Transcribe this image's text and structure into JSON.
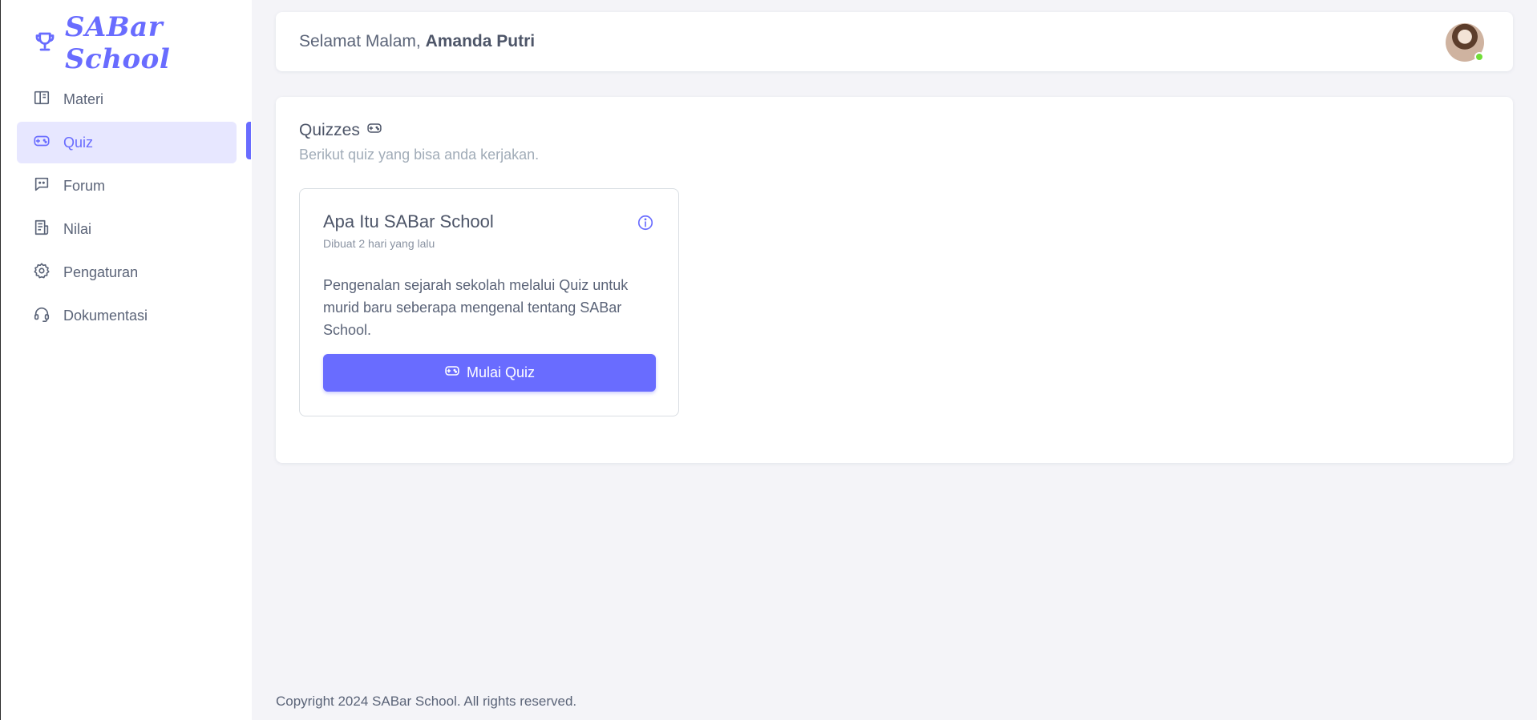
{
  "brand": {
    "name": "SABar School",
    "icon": "trophy-icon",
    "color": "#696cff"
  },
  "sidebar": {
    "items": [
      {
        "label": "Materi",
        "icon": "book-icon"
      },
      {
        "label": "Quiz",
        "icon": "gamepad-icon",
        "active": true
      },
      {
        "label": "Forum",
        "icon": "chat-icon"
      },
      {
        "label": "Nilai",
        "icon": "report-icon"
      },
      {
        "label": "Pengaturan",
        "icon": "gear-icon"
      },
      {
        "label": "Dokumentasi",
        "icon": "headset-icon"
      }
    ]
  },
  "header": {
    "greeting": "Selamat Malam,",
    "user_name": "Amanda Putri",
    "status": "online"
  },
  "main": {
    "title": "Quizzes",
    "subtitle": "Berikut quiz yang bisa anda kerjakan.",
    "quizzes": [
      {
        "title": "Apa Itu SABar School",
        "created": "Dibuat 2 hari yang lalu",
        "description": "Pengenalan sejarah sekolah melalui Quiz untuk murid baru seberapa mengenal tentang SABar School.",
        "button_label": "Mulai Quiz"
      }
    ]
  },
  "footer": {
    "copyright": "Copyright 2024 SABar School. All rights reserved."
  },
  "colors": {
    "accent": "#696cff",
    "active_bg": "#e7e7ff",
    "online": "#71dd37"
  }
}
